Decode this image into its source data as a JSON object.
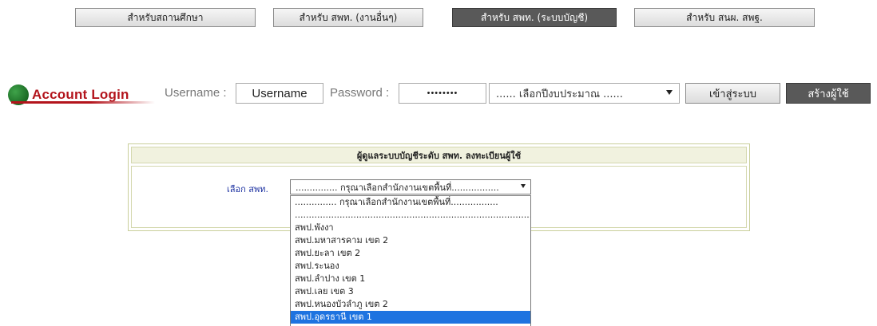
{
  "tabs": [
    {
      "label": "สำหรับสถานศึกษา",
      "active": false
    },
    {
      "label": "สำหรับ สพท. (งานอื่นๆ)",
      "active": false
    },
    {
      "label": "สำหรับ สพท. (ระบบบัญชี)",
      "active": true
    },
    {
      "label": "สำหรับ สนผ. สพฐ.",
      "active": false
    }
  ],
  "login": {
    "title": "Account Login",
    "username_label": "Username :",
    "username_value": "Username",
    "password_label": "Password :",
    "password_value": "••••••••",
    "year_select": "...... เลือกปีงบประมาณ ......",
    "login_button": "เข้าสู่ระบบ",
    "create_user_button": "สร้างผู้ใช้"
  },
  "panel": {
    "header": "ผู้ดูแลระบบบัญชีระดับ สพท. ลงทะเบียนผู้ใช้",
    "select_label": "เลือก สพท.",
    "select_value": "............... กรุณาเลือกสำนักงานเขตพื้นที่.................",
    "options": [
      "............... กรุณาเลือกสำนักงานเขตพื้นที่.................",
      "................................................................................................",
      "สพป.พังงา",
      "สพป.มหาสารคาม เขต 2",
      "สพป.ยะลา เขต 2",
      "สพป.ระนอง",
      "สพป.ลำปาง เขต 1",
      "สพป.เลย เขต 3",
      "สพป.หนองบัวลำภู เขต 2",
      "สพป.อุดรธานี เขต 1"
    ],
    "selected_option_index": 9
  },
  "colors": {
    "active_tab": "#595959",
    "login_title": "#b3141c",
    "select_label": "#1a2fa0",
    "dropdown_highlight": "#1e73e0",
    "panel_header_bg": "#f1f2df"
  }
}
